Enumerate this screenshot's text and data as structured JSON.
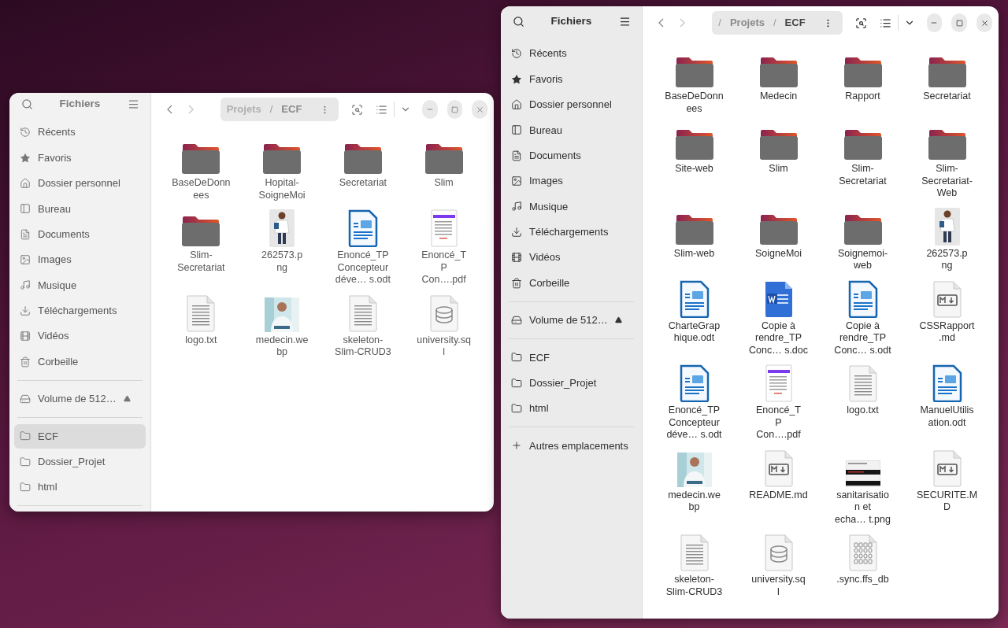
{
  "windows": [
    {
      "active": false,
      "title": "Fichiers",
      "path": [
        {
          "kind": "segment",
          "label": "Projets"
        },
        {
          "kind": "separator",
          "label": "/"
        },
        {
          "kind": "current",
          "label": "ECF"
        }
      ],
      "sidebar": [
        {
          "kind": "recent",
          "label": "Récents",
          "selected": false
        },
        {
          "kind": "star",
          "label": "Favoris",
          "selected": false
        },
        {
          "kind": "home",
          "label": "Dossier personnel",
          "selected": false
        },
        {
          "kind": "desktop",
          "label": "Bureau",
          "selected": false
        },
        {
          "kind": "documents",
          "label": "Documents",
          "selected": false
        },
        {
          "kind": "images",
          "label": "Images",
          "selected": false
        },
        {
          "kind": "music",
          "label": "Musique",
          "selected": false
        },
        {
          "kind": "download",
          "label": "Téléchargements",
          "selected": false
        },
        {
          "kind": "videos",
          "label": "Vidéos",
          "selected": false
        },
        {
          "kind": "trash",
          "label": "Corbeille",
          "selected": false
        },
        {
          "kind": "divider"
        },
        {
          "kind": "volume",
          "label": "Volume de 512…",
          "selected": false
        },
        {
          "kind": "divider"
        },
        {
          "kind": "folder",
          "label": "ECF",
          "selected": true
        },
        {
          "kind": "folder",
          "label": "Dossier_Projet",
          "selected": false
        },
        {
          "kind": "folder",
          "label": "html",
          "selected": false
        },
        {
          "kind": "divider"
        }
      ],
      "files": [
        {
          "kind": "folder",
          "label": [
            "BaseDeDonn",
            "ees"
          ]
        },
        {
          "kind": "folder",
          "label": [
            "Hopital-",
            "SoigneMoi"
          ]
        },
        {
          "kind": "folder",
          "label": [
            "Secretariat"
          ]
        },
        {
          "kind": "folder",
          "label": [
            "Slim"
          ]
        },
        {
          "kind": "folder",
          "label": [
            "Slim-",
            "Secretariat"
          ]
        },
        {
          "kind": "figure",
          "label": [
            "262573.p",
            "ng"
          ]
        },
        {
          "kind": "odt",
          "label": [
            "Enoncé_TP",
            "Concepteur",
            "déve… s.odt"
          ]
        },
        {
          "kind": "pdf",
          "label": [
            "Enoncé_T",
            "P",
            "Con….pdf"
          ]
        },
        {
          "kind": "txt",
          "label": [
            "logo.txt"
          ]
        },
        {
          "label": [
            "medecin.we",
            "bp"
          ]
        },
        {
          "kind": "txt",
          "label": [
            "skeleton-",
            "Slim-CRUD3"
          ]
        },
        {
          "kind": "sql",
          "label": [
            "university.sq",
            "l"
          ]
        }
      ]
    },
    {
      "active": true,
      "title": "Fichiers",
      "path": [
        {
          "kind": "separator",
          "label": "/"
        },
        {
          "kind": "segment",
          "label": "Projets"
        },
        {
          "kind": "separator",
          "label": "/"
        },
        {
          "kind": "current",
          "label": "ECF"
        }
      ],
      "sidebar": [
        {
          "kind": "recent",
          "label": "Récents",
          "selected": false
        },
        {
          "kind": "star",
          "label": "Favoris",
          "selected": false
        },
        {
          "kind": "home",
          "label": "Dossier personnel",
          "selected": false
        },
        {
          "kind": "desktop",
          "label": "Bureau",
          "selected": false
        },
        {
          "kind": "documents",
          "label": "Documents",
          "selected": false
        },
        {
          "kind": "images",
          "label": "Images",
          "selected": false
        },
        {
          "kind": "music",
          "label": "Musique",
          "selected": false
        },
        {
          "kind": "download",
          "label": "Téléchargements",
          "selected": false
        },
        {
          "kind": "videos",
          "label": "Vidéos",
          "selected": false
        },
        {
          "kind": "trash",
          "label": "Corbeille",
          "selected": false
        },
        {
          "kind": "divider"
        },
        {
          "kind": "volume",
          "label": "Volume de 512…",
          "selected": false
        },
        {
          "kind": "divider"
        },
        {
          "kind": "folder",
          "label": "ECF",
          "selected": false
        },
        {
          "kind": "folder",
          "label": "Dossier_Projet",
          "selected": false
        },
        {
          "kind": "folder",
          "label": "html",
          "selected": false
        },
        {
          "kind": "divider"
        },
        {
          "kind": "other",
          "label": "Autres emplacements",
          "selected": false
        }
      ],
      "files": [
        {
          "kind": "folder",
          "label": [
            "BaseDeDonn",
            "ees"
          ]
        },
        {
          "kind": "folder",
          "label": [
            "Medecin"
          ]
        },
        {
          "kind": "folder",
          "label": [
            "Rapport"
          ]
        },
        {
          "kind": "folder",
          "label": [
            "Secretariat"
          ]
        },
        {
          "kind": "folder",
          "label": [
            "Site-web"
          ]
        },
        {
          "kind": "folder",
          "label": [
            "Slim"
          ]
        },
        {
          "kind": "folder",
          "label": [
            "Slim-",
            "Secretariat"
          ]
        },
        {
          "kind": "folder",
          "label": [
            "Slim-",
            "Secretariat-",
            "Web"
          ]
        },
        {
          "kind": "folder",
          "label": [
            "Slim-web"
          ]
        },
        {
          "kind": "folder",
          "label": [
            "SoigneMoi"
          ]
        },
        {
          "kind": "folder",
          "label": [
            "Soignemoi-",
            "web"
          ]
        },
        {
          "kind": "figure",
          "label": [
            "262573.p",
            "ng"
          ]
        },
        {
          "kind": "odt",
          "label": [
            "CharteGrap",
            "hique.odt"
          ]
        },
        {
          "kind": "doc",
          "label": [
            "Copie à",
            "rendre_TP",
            "Conc… s.doc"
          ]
        },
        {
          "kind": "odt",
          "label": [
            "Copie à",
            "rendre_TP",
            "Conc… s.odt"
          ]
        },
        {
          "kind": "md",
          "label": [
            "CSSRapport",
            ".md"
          ]
        },
        {
          "kind": "odt",
          "label": [
            "Enoncé_TP",
            "Concepteur",
            "déve… s.odt"
          ]
        },
        {
          "kind": "pdf",
          "label": [
            "Enoncé_T",
            "P",
            "Con….pdf"
          ]
        },
        {
          "kind": "txt",
          "label": [
            "logo.txt"
          ]
        },
        {
          "kind": "odt",
          "label": [
            "ManuelUtilis",
            "ation.odt"
          ]
        },
        {
          "label": [
            "medecin.we",
            "bp"
          ]
        },
        {
          "kind": "md",
          "label": [
            "README.md"
          ]
        },
        {
          "kind": "screenshot",
          "label": [
            "sanitarisatio",
            "n et",
            "echa… t.png"
          ]
        },
        {
          "kind": "md",
          "label": [
            "SECURITE.M",
            "D"
          ]
        },
        {
          "kind": "txt",
          "label": [
            "skeleton-",
            "Slim-CRUD3"
          ]
        },
        {
          "kind": "sql",
          "label": [
            "university.sq",
            "l"
          ]
        },
        {
          "kind": "binary",
          "label": [
            ".sync.ffs_db"
          ]
        }
      ]
    }
  ]
}
